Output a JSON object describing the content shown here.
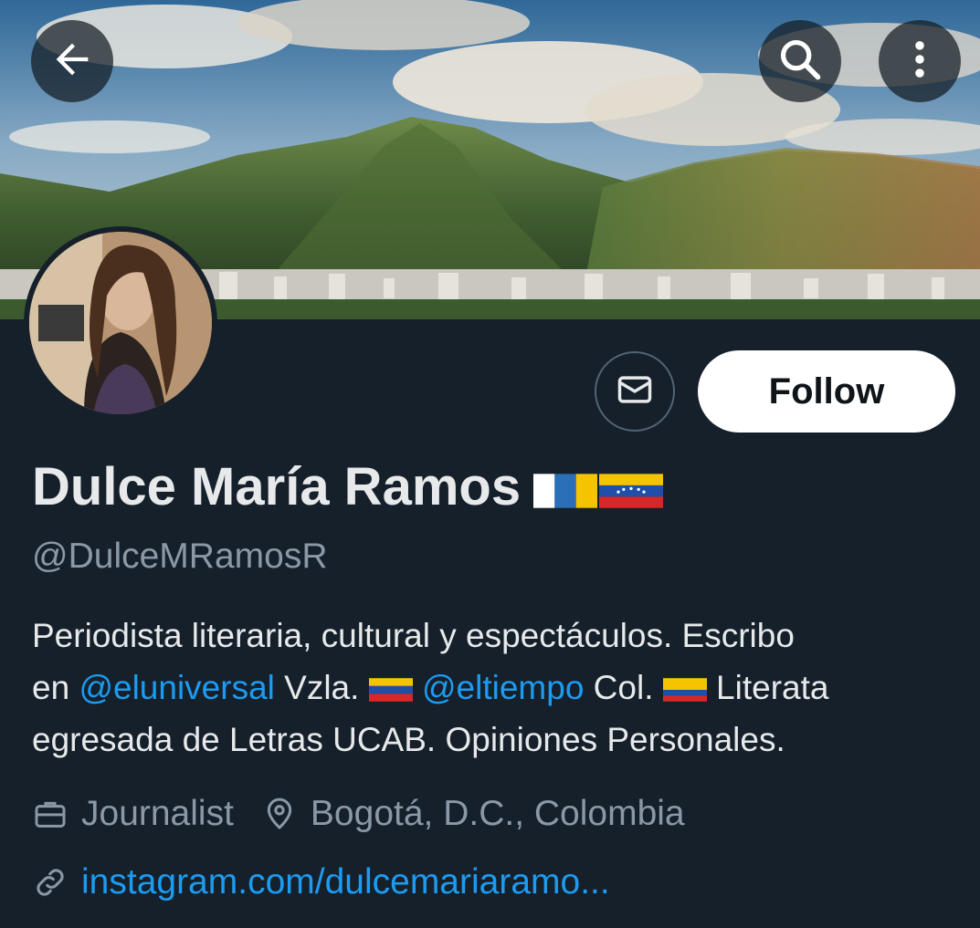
{
  "header": {
    "back_icon": "arrow-left-icon",
    "search_icon": "search-icon",
    "more_icon": "more-vertical-icon"
  },
  "actions": {
    "message_icon": "envelope-icon",
    "follow_label": "Follow"
  },
  "profile": {
    "name": "Dulce María Ramos",
    "name_flags": [
      "flag-canary-islands-icon",
      "flag-venezuela-icon"
    ],
    "handle": "@DulceMRamosR",
    "bio": {
      "line1": "Periodista literaria, cultural y espectáculos. Escribo",
      "line2_pre": "en ",
      "mention1": "@eluniversal",
      "line2_mid1": " Vzla. ",
      "line2_space": " ",
      "mention2": "@eltiempo",
      "line2_mid2": " Col. ",
      "line2_end": " Literata",
      "line3": "egresada de Letras UCAB. Opiniones Personales."
    },
    "profession": "Journalist",
    "location": "Bogotá, D.C., Colombia",
    "website": "instagram.com/dulcemariaramo..."
  },
  "colors": {
    "background": "#15202b",
    "primary_text": "#e7e9ea",
    "secondary_text": "#8b98a5",
    "link": "#1d9bf0",
    "follow_bg": "#ffffff"
  }
}
